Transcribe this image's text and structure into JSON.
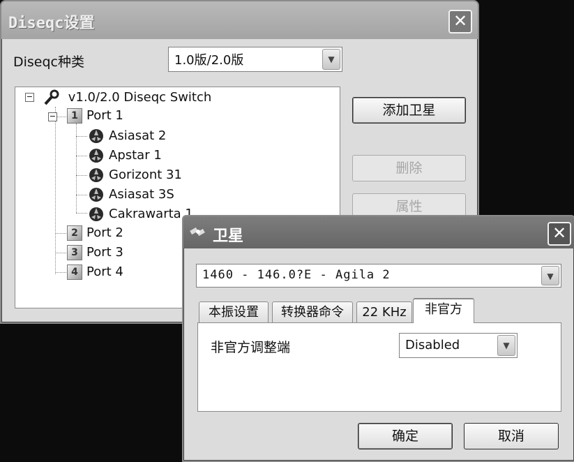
{
  "diseqc_window": {
    "title": "Diseqc设置",
    "type_label": "Diseqc种类",
    "type_value": "1.0版/2.0版",
    "buttons": {
      "add_satellite": "添加卫星",
      "delete": "删除",
      "properties": "属性"
    },
    "tree": {
      "root": {
        "label": "v1.0/2.0 Diseqc Switch",
        "expander": "−"
      },
      "ports": [
        {
          "number": "1",
          "label": "Port 1",
          "expander": "−",
          "satellites": [
            "Asiasat 2",
            "Apstar 1",
            "Gorizont 31",
            "Asiasat 3S",
            "Cakrawarta 1"
          ]
        },
        {
          "number": "2",
          "label": "Port 2"
        },
        {
          "number": "3",
          "label": "Port 3"
        },
        {
          "number": "4",
          "label": "Port 4"
        }
      ]
    }
  },
  "satellite_window": {
    "title": "卫星",
    "satellite_select_value": "1460 - 146.0?E - Agila 2",
    "tabs": [
      {
        "label": "本振设置",
        "active": false
      },
      {
        "label": "转换器命令",
        "active": false
      },
      {
        "label": "22 KHz",
        "active": false
      },
      {
        "label": "非官方",
        "active": true
      }
    ],
    "unofficial": {
      "field_label": "非官方调整端",
      "field_value": "Disabled"
    },
    "buttons": {
      "ok": "确定",
      "cancel": "取消"
    }
  },
  "icons": {
    "close": "close-icon",
    "dropdown": "chevron-down-icon",
    "switch": "wrench-icon",
    "satellite": "satellite-icon",
    "window": "satellite-window-icon"
  }
}
